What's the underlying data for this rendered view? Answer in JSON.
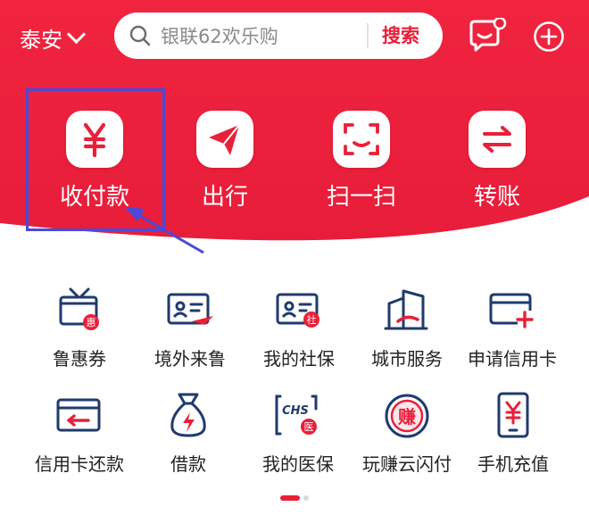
{
  "header": {
    "city": "泰安",
    "search_placeholder": "银联62欢乐购",
    "search_button": "搜索"
  },
  "quick_actions": [
    {
      "label": "收付款",
      "icon": "yen-icon"
    },
    {
      "label": "出行",
      "icon": "paper-plane-icon"
    },
    {
      "label": "扫一扫",
      "icon": "scan-icon"
    },
    {
      "label": "转账",
      "icon": "transfer-icon"
    }
  ],
  "services": [
    {
      "label": "鲁惠券",
      "icon": "coupon-tv-icon",
      "badge": "惠"
    },
    {
      "label": "境外来鲁",
      "icon": "id-card-plane-icon"
    },
    {
      "label": "我的社保",
      "icon": "id-card-social-icon",
      "badge": "社"
    },
    {
      "label": "城市服务",
      "icon": "city-building-icon"
    },
    {
      "label": "申请信用卡",
      "icon": "card-plus-icon"
    },
    {
      "label": "信用卡还款",
      "icon": "card-return-icon"
    },
    {
      "label": "借款",
      "icon": "money-bag-icon"
    },
    {
      "label": "我的医保",
      "icon": "chs-medical-icon",
      "badge": "医",
      "code": "CHS"
    },
    {
      "label": "玩赚云闪付",
      "icon": "earn-coin-icon",
      "badge": "赚"
    },
    {
      "label": "手机充值",
      "icon": "phone-yen-icon"
    }
  ],
  "colors": {
    "brand_red": "#e8203a",
    "icon_navy": "#1f3a6e",
    "highlight": "#4a4ad8"
  }
}
